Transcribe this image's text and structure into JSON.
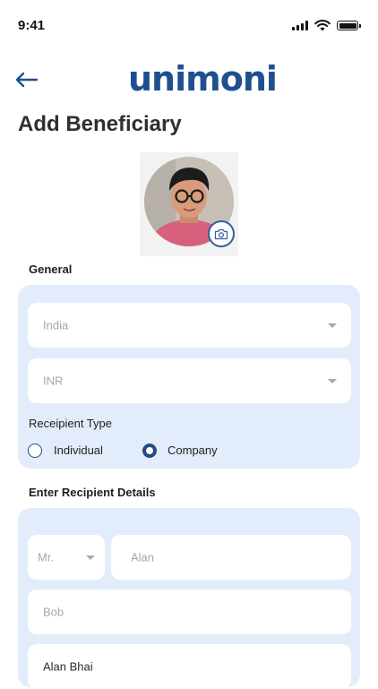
{
  "status": {
    "time": "9:41"
  },
  "header": {
    "logo_text": "unimoni",
    "title": "Add Beneficiary"
  },
  "icons": {
    "back": "arrow-left-icon",
    "camera": "camera-icon",
    "signal": "cellular-signal-icon",
    "wifi": "wifi-icon",
    "battery": "battery-icon"
  },
  "colors": {
    "brand_blue": "#1f4f8f",
    "brand_cyan": "#2ab3d6",
    "panel_bg": "#e3ecfa",
    "radio": "#254c80"
  },
  "general": {
    "label": "General",
    "country": {
      "value": "India"
    },
    "currency": {
      "value": "INR"
    },
    "recipient_type": {
      "label": "Receipient Type",
      "options": [
        {
          "label": "Individual",
          "selected": false
        },
        {
          "label": "Company",
          "selected": true
        }
      ]
    }
  },
  "recipient": {
    "label": "Enter Recipient Details",
    "salutation": {
      "value": "Mr."
    },
    "first_name": {
      "value": "Alan"
    },
    "last_name": {
      "value": "Bob"
    },
    "nickname": {
      "value": "Alan Bhai"
    }
  }
}
